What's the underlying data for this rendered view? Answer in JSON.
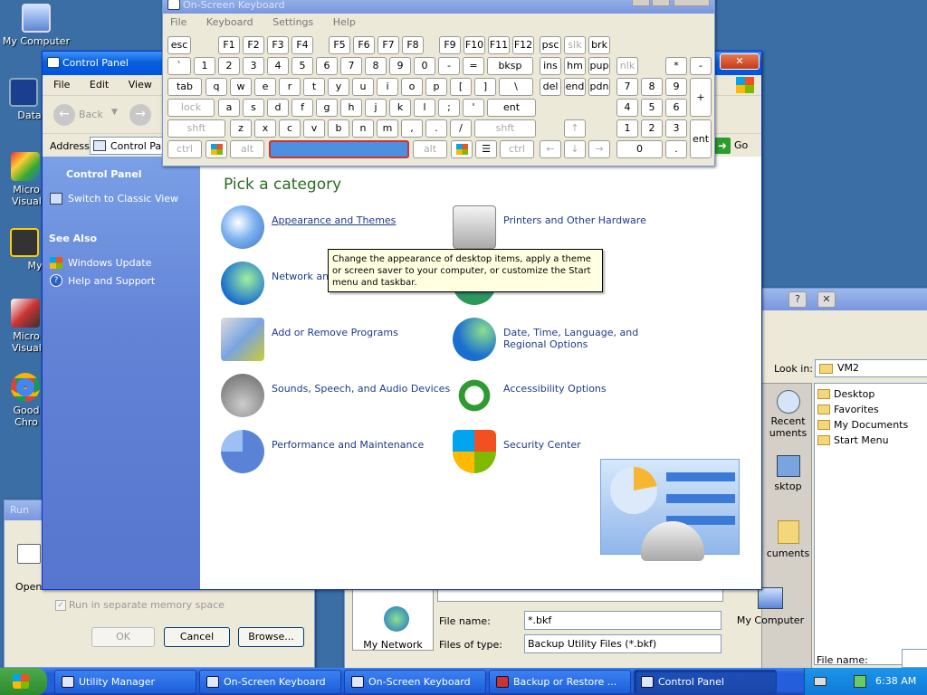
{
  "desktop": {
    "icons": [
      {
        "label": "My Computer"
      },
      {
        "label": "DataWa"
      },
      {
        "label": "Micro Visual"
      },
      {
        "label": "Myp"
      },
      {
        "label": "Micro Visual"
      },
      {
        "label": "Good Chro"
      }
    ]
  },
  "osk": {
    "title": "On-Screen Keyboard",
    "menu": [
      "File",
      "Keyboard",
      "Settings",
      "Help"
    ],
    "rows": [
      [
        "esc",
        "F1",
        "F2",
        "F3",
        "F4",
        "F5",
        "F6",
        "F7",
        "F8",
        "F9",
        "F10",
        "F11",
        "F12",
        "psc",
        "slk",
        "brk"
      ],
      [
        "`",
        "1",
        "2",
        "3",
        "4",
        "5",
        "6",
        "7",
        "8",
        "9",
        "0",
        "-",
        "=",
        "bksp",
        "ins",
        "hm",
        "pup",
        "nlk",
        "/",
        "*",
        "-"
      ],
      [
        "tab",
        "q",
        "w",
        "e",
        "r",
        "t",
        "y",
        "u",
        "i",
        "o",
        "p",
        "[",
        "]",
        "\\",
        "del",
        "end",
        "pdn",
        "7",
        "8",
        "9",
        "+"
      ],
      [
        "lock",
        "a",
        "s",
        "d",
        "f",
        "g",
        "h",
        "j",
        "k",
        "l",
        ";",
        "'",
        "ent",
        "4",
        "5",
        "6"
      ],
      [
        "shft",
        "z",
        "x",
        "c",
        "v",
        "b",
        "n",
        "m",
        ",",
        ".",
        "/",
        "shft",
        "1",
        "2",
        "3",
        "ent"
      ],
      [
        "ctrl",
        "alt",
        "alt",
        "ctrl",
        "0",
        "."
      ]
    ]
  },
  "control_panel": {
    "title": "Control Panel",
    "menu": [
      "File",
      "Edit",
      "View",
      "Fa"
    ],
    "back_label": "Back",
    "address_label": "Address",
    "address_value": "Control Panel",
    "go_label": "Go",
    "side_title": "Control Panel",
    "switch_view": "Switch to Classic View",
    "see_also": "See Also",
    "windows_update": "Windows Update",
    "help_support": "Help and Support",
    "heading": "Pick a category",
    "categories": [
      {
        "label": "Appearance and Themes",
        "icon": "appearance-icon"
      },
      {
        "label": "Printers and Other Hardware",
        "icon": "printer-icon"
      },
      {
        "label": "Network and",
        "icon": "network-icon"
      },
      {
        "label": "Add or Remove Programs",
        "icon": "programs-icon"
      },
      {
        "label": "Date, Time, Language, and Regional Options",
        "icon": "date-icon"
      },
      {
        "label": "Sounds, Speech, and Audio Devices",
        "icon": "sound-icon"
      },
      {
        "label": "Accessibility Options",
        "icon": "accessibility-icon"
      },
      {
        "label": "Performance and Maintenance",
        "icon": "performance-icon"
      },
      {
        "label": "Security Center",
        "icon": "shield-icon"
      }
    ],
    "tooltip": "Change the appearance of desktop items, apply a theme or screen saver to your computer, or customize the Start menu and taskbar."
  },
  "run": {
    "title": "Run",
    "open_label": "Open",
    "checkbox_label": "Run in separate memory space",
    "ok": "OK",
    "cancel": "Cancel",
    "browse": "Browse..."
  },
  "file_dialog": {
    "help": "?",
    "look_in_label": "Look in:",
    "look_in_value": "VM2",
    "places": [
      "Recent uments",
      "sktop",
      "cuments",
      "My Computer",
      "My Network"
    ],
    "items": [
      "Desktop",
      "Favorites",
      "My Documents",
      "Start Menu"
    ],
    "file_name_label": "File name:",
    "file_name_value": "*.bkf",
    "file_type_label": "Files of type:",
    "file_type_value": "Backup Utility Files (*.bkf)"
  },
  "taskbar": {
    "buttons": [
      "Utility Manager",
      "On-Screen Keyboard",
      "On-Screen Keyboard",
      "Backup or Restore ...",
      "Control Panel"
    ],
    "clock": "6:38 AM"
  }
}
